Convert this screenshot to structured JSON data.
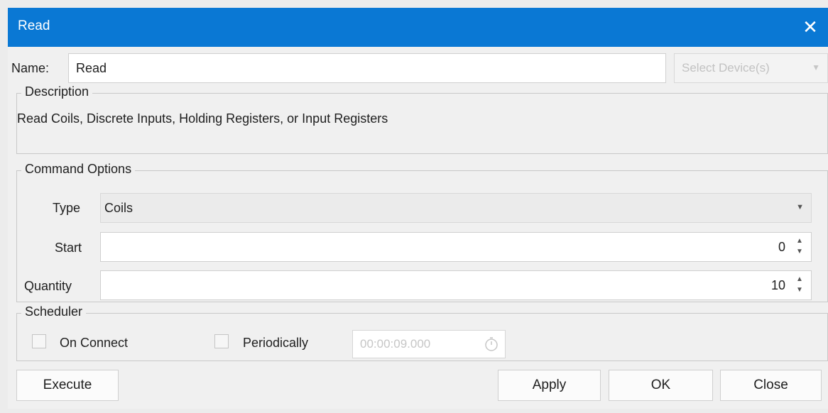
{
  "window": {
    "title": "Read"
  },
  "name_row": {
    "label": "Name:",
    "value": "Read",
    "device_placeholder": "Select Device(s)"
  },
  "description": {
    "group_title": "Description",
    "text": "Read Coils, Discrete Inputs, Holding Registers, or Input Registers"
  },
  "command_options": {
    "group_title": "Command Options",
    "type_label": "Type",
    "type_value": "Coils",
    "start_label": "Start",
    "start_value": "0",
    "quantity_label": "Quantity",
    "quantity_value": "10"
  },
  "scheduler": {
    "group_title": "Scheduler",
    "on_connect_label": "On Connect",
    "periodically_label": "Periodically",
    "interval_value": "00:00:09.000"
  },
  "buttons": {
    "execute": "Execute",
    "apply": "Apply",
    "ok": "OK",
    "close": "Close"
  },
  "icons": {
    "close": "close-icon",
    "dropdown": "chevron-down-icon",
    "spinner": "spinner-icon",
    "timer": "stopwatch-icon"
  }
}
